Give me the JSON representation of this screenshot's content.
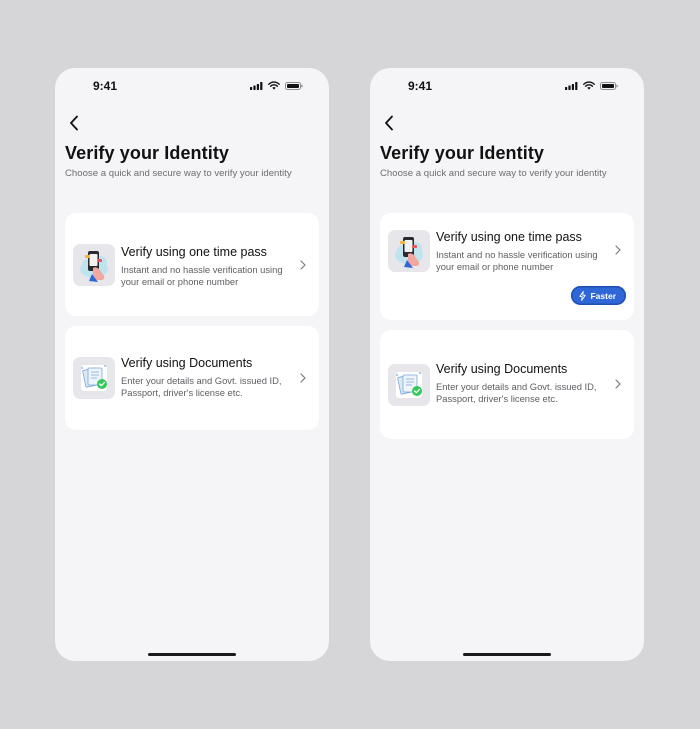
{
  "status": {
    "time": "9:41"
  },
  "header": {
    "title": "Verify your Identity",
    "subtitle": "Choose a quick and secure way to verify your identity"
  },
  "options": [
    {
      "title": "Verify using one time pass",
      "description": "Instant and no hassle verification using your email or phone number",
      "icon": "phone-hand-icon"
    },
    {
      "title": "Verify using Documents",
      "description": "Enter your details and Govt. issued ID, Passport, driver's license etc.",
      "icon": "documents-check-icon"
    }
  ],
  "badge": {
    "label": "Faster",
    "icon": "lightning-icon",
    "color": "#2f67d6"
  }
}
